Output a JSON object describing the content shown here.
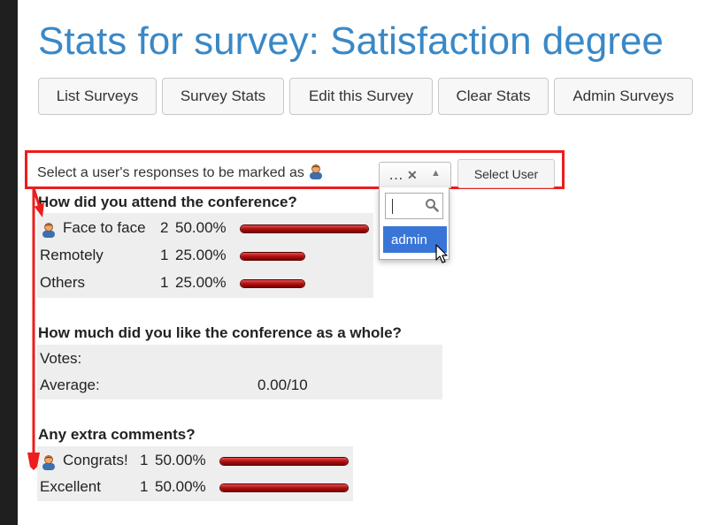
{
  "page": {
    "title": "Stats for survey: Satisfaction degree"
  },
  "nav": {
    "buttons": [
      "List Surveys",
      "Survey Stats",
      "Edit this Survey",
      "Clear Stats",
      "Admin Surveys"
    ]
  },
  "user_select": {
    "label": "Select a user's responses to be marked as",
    "combo_value": "…",
    "select_button": "Select User",
    "options": [
      "admin"
    ],
    "highlighted_option": "admin"
  },
  "questions": [
    {
      "title": "How did you attend the conference?",
      "rows": [
        {
          "label": "Face to face",
          "count": "2",
          "percent": "50.00%",
          "marked": true,
          "fraction": 0.5
        },
        {
          "label": "Remotely",
          "count": "1",
          "percent": "25.00%",
          "marked": false,
          "fraction": 0.25
        },
        {
          "label": "Others",
          "count": "1",
          "percent": "25.00%",
          "marked": false,
          "fraction": 0.25
        }
      ]
    },
    {
      "title": "How much did you like the conference as a whole?",
      "votes_label": "Votes:",
      "votes_value": "",
      "average_label": "Average:",
      "average_value": "0.00/10"
    },
    {
      "title": "Any extra comments?",
      "rows": [
        {
          "label": "Congrats!",
          "count": "1",
          "percent": "50.00%",
          "marked": true,
          "fraction": 0.5
        },
        {
          "label": "Excellent",
          "count": "1",
          "percent": "50.00%",
          "marked": false,
          "fraction": 0.5
        }
      ]
    }
  ],
  "colors": {
    "title": "#3a88c6",
    "highlight": "#ee1c1c",
    "bar": "#b01010",
    "selected_option": "#3875d7"
  }
}
